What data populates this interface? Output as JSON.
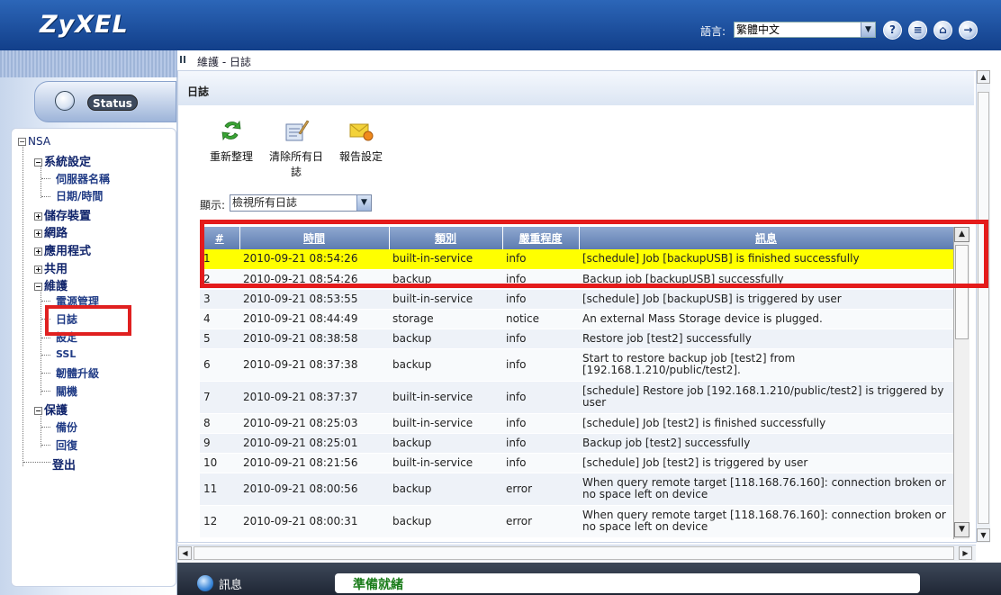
{
  "header": {
    "logo": "ZyXEL",
    "language_label": "語言:",
    "language_value": "繁體中文",
    "icons": [
      "help-icon",
      "notes-icon",
      "home-icon",
      "logout-icon"
    ],
    "icon_glyphs": [
      "?",
      "≡",
      "⌂",
      "→"
    ]
  },
  "sidebar": {
    "status_label": "Status",
    "tree": {
      "root": "NSA",
      "system_settings": "系統設定",
      "server_name": "伺服器名稱",
      "date_time": "日期/時間",
      "storage": "儲存裝置",
      "network": "網路",
      "applications": "應用程式",
      "sharing": "共用",
      "maintenance": "維護",
      "power_management": "電源管理",
      "log": "日誌",
      "config": "設定",
      "ssl": "SSL",
      "firmware_upgrade": "韌體升級",
      "shutdown": "關機",
      "protection": "保護",
      "backup": "備份",
      "restore": "回復",
      "logout": "登出"
    }
  },
  "breadcrumb": "維護 - 日誌",
  "main": {
    "title": "日誌",
    "toolbar": {
      "refresh": "重新整理",
      "clear_line1": "清除所有日",
      "clear_line2": "誌",
      "report": "報告設定"
    },
    "filter_label": "顯示:",
    "filter_value": "檢視所有日誌"
  },
  "table": {
    "columns": [
      "#",
      "時間",
      "類別",
      "嚴重程度",
      "訊息"
    ],
    "rows": [
      {
        "num": "1",
        "time": "2010-09-21 08:54:26",
        "category": "built-in-service",
        "severity": "info",
        "message": "[schedule] Job [backupUSB] is finished successfully"
      },
      {
        "num": "2",
        "time": "2010-09-21 08:54:26",
        "category": "backup",
        "severity": "info",
        "message": "Backup job [backupUSB] successfully"
      },
      {
        "num": "3",
        "time": "2010-09-21 08:53:55",
        "category": "built-in-service",
        "severity": "info",
        "message": "[schedule] Job [backupUSB] is triggered by user"
      },
      {
        "num": "4",
        "time": "2010-09-21 08:44:49",
        "category": "storage",
        "severity": "notice",
        "message": "An external Mass Storage device is plugged."
      },
      {
        "num": "5",
        "time": "2010-09-21 08:38:58",
        "category": "backup",
        "severity": "info",
        "message": "Restore job [test2] successfully"
      },
      {
        "num": "6",
        "time": "2010-09-21 08:37:38",
        "category": "backup",
        "severity": "info",
        "message": "Start to restore backup job [test2] from [192.168.1.210/public/test2]."
      },
      {
        "num": "7",
        "time": "2010-09-21 08:37:37",
        "category": "built-in-service",
        "severity": "info",
        "message": "[schedule] Restore job [192.168.1.210/public/test2] is triggered by user"
      },
      {
        "num": "8",
        "time": "2010-09-21 08:25:03",
        "category": "built-in-service",
        "severity": "info",
        "message": "[schedule] Job [test2] is finished successfully"
      },
      {
        "num": "9",
        "time": "2010-09-21 08:25:01",
        "category": "backup",
        "severity": "info",
        "message": "Backup job [test2] successfully"
      },
      {
        "num": "10",
        "time": "2010-09-21 08:21:56",
        "category": "built-in-service",
        "severity": "info",
        "message": "[schedule] Job [test2] is triggered by user"
      },
      {
        "num": "11",
        "time": "2010-09-21 08:00:56",
        "category": "backup",
        "severity": "error",
        "message": "When query remote target [118.168.76.160]: connection broken or no space left on device"
      },
      {
        "num": "12",
        "time": "2010-09-21 08:00:31",
        "category": "backup",
        "severity": "error",
        "message": "When query remote target [118.168.76.160]: connection broken or no space left on device"
      }
    ]
  },
  "statusbar": {
    "label": "訊息",
    "message": "準備就緒"
  },
  "colors": {
    "header": "#1f55a8",
    "highlight_row": "#ffff00",
    "annotation_red": "#e41b1b",
    "status_text": "#1a7c1a"
  }
}
